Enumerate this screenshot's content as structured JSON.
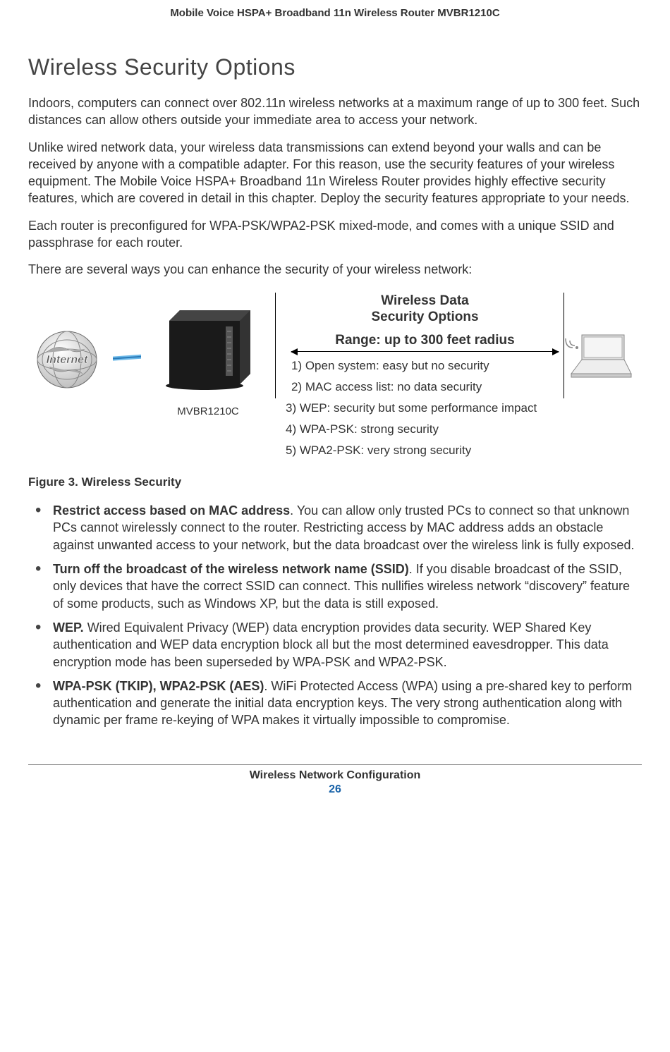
{
  "header": "Mobile Voice HSPA+ Broadband 11n Wireless Router MVBR1210C",
  "section_title": "Wireless Security Options",
  "para1": "Indoors, computers can connect over 802.11n wireless networks at a maximum range of up to 300 feet. Such distances can allow others outside your immediate area to access your network.",
  "para2": "Unlike wired network data, your wireless data transmissions can extend beyond your walls and can be received by anyone with a compatible adapter. For this reason, use the security features of your wireless equipment. The Mobile Voice HSPA+ Broadband 11n Wireless Router provides highly effective security features, which are covered in detail in this chapter. Deploy the security features appropriate to your needs.",
  "para3": "Each router is preconfigured for WPA-PSK/WPA2-PSK mixed-mode, and comes with a unique SSID and passphrase for each router.",
  "para4": "There are several ways you can enhance the security of your wireless network:",
  "diagram": {
    "globe_label": "Internet",
    "router_label": "MVBR1210C",
    "title_line1": "Wireless Data",
    "title_line2": "Security Options",
    "range": "Range: up to 300 feet radius",
    "opt1": "1) Open system: easy but no security",
    "opt2": "2) MAC access list: no data security",
    "opt3": "3) WEP: security but some performance impact",
    "opt4": "4) WPA-PSK: strong security",
    "opt5": "5) WPA2-PSK: very strong security"
  },
  "figure_caption": "Figure 3. Wireless Security",
  "bullets": {
    "b1_bold": "Restrict access based on MAC address",
    "b1_text": ". You can allow only trusted PCs to connect so that unknown PCs cannot wirelessly connect to the router. Restricting access by MAC address adds an obstacle against unwanted access to your network, but the data broadcast over the wireless link is fully exposed.",
    "b2_bold": "Turn off the broadcast of the wireless network name (SSID)",
    "b2_text": ". If you disable broadcast of the SSID, only devices that have the correct SSID can connect. This nullifies wireless network “discovery” feature of some products, such as Windows XP, but the data is still exposed.",
    "b3_bold": "WEP.",
    "b3_text": " Wired Equivalent Privacy (WEP) data encryption provides data security. WEP Shared Key authentication and WEP data encryption block all but the most determined eavesdropper. This data encryption mode has been superseded by WPA-PSK and WPA2-PSK.",
    "b4_bold": "WPA-PSK (TKIP), WPA2-PSK (AES)",
    "b4_text": ". WiFi Protected Access (WPA) using a pre-shared key to perform authentication and generate the initial data encryption keys. The very strong authentication along with dynamic per frame re-keying of WPA makes it virtually impossible to compromise."
  },
  "footer_title": "Wireless Network Configuration",
  "footer_page": "26"
}
